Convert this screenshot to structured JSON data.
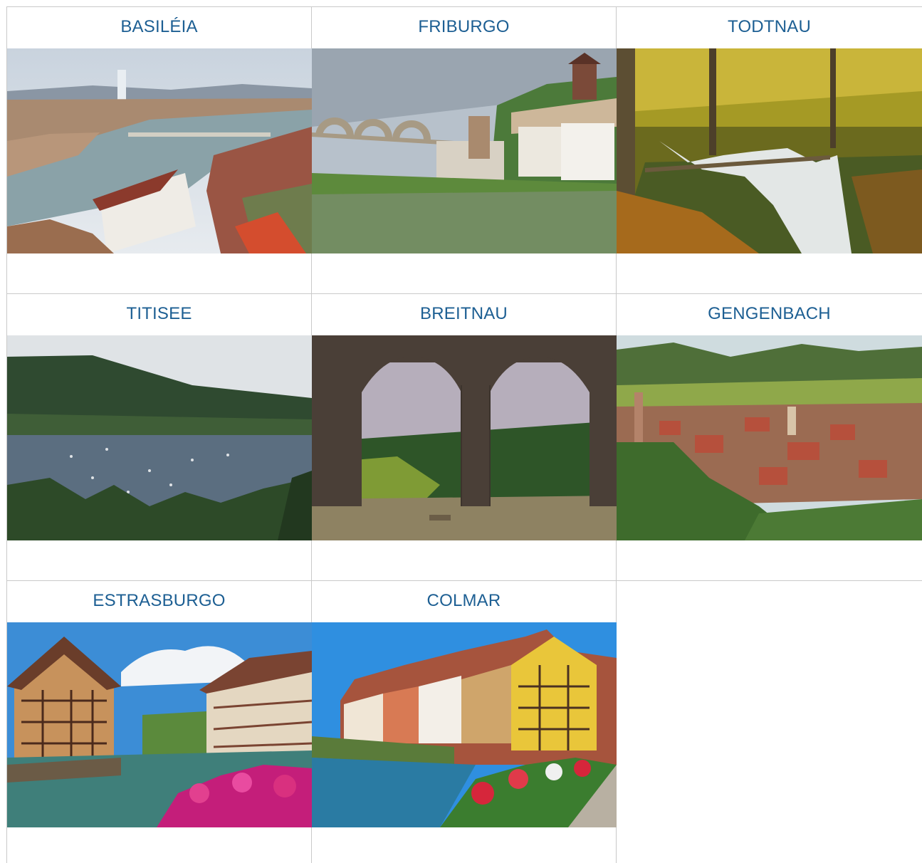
{
  "destinations": [
    {
      "title": "BASILÉIA"
    },
    {
      "title": "FRIBURGO"
    },
    {
      "title": "TODTNAU"
    },
    {
      "title": "TITISEE"
    },
    {
      "title": "BREITNAU"
    },
    {
      "title": "GENGENBACH"
    },
    {
      "title": "ESTRASBURGO"
    },
    {
      "title": "COLMAR"
    }
  ],
  "colors": {
    "title_link": "#1d5f93",
    "border": "#c9c9c9"
  }
}
